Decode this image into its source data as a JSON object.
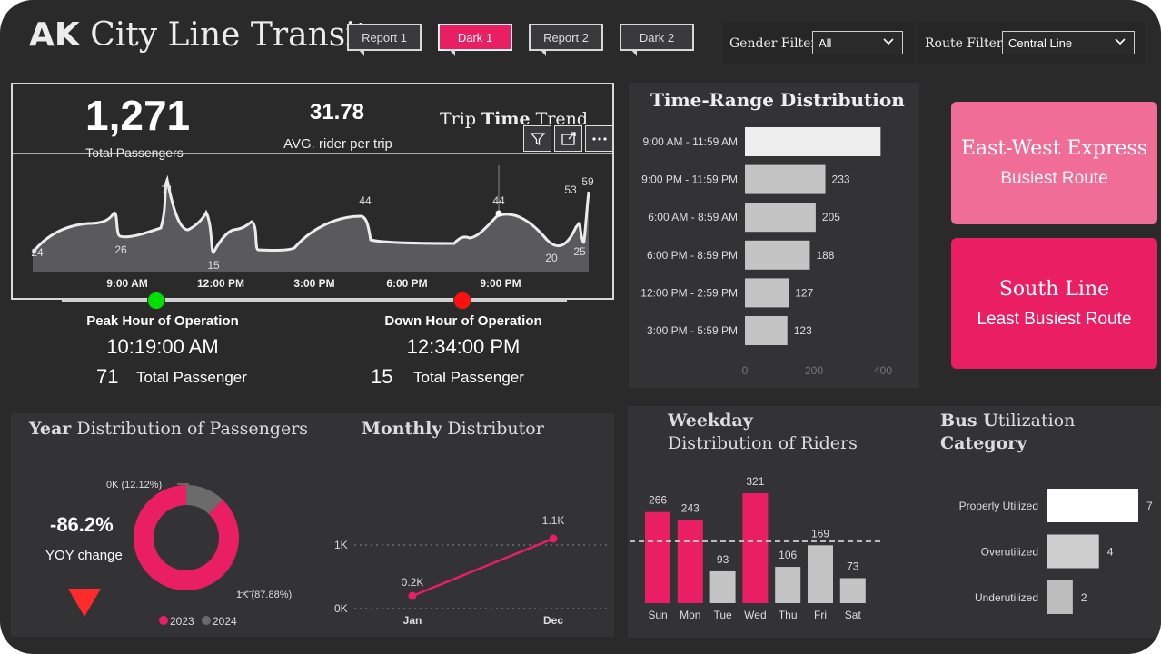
{
  "header": {
    "title_bold": "AK",
    "title_rest": "City Line Transit",
    "buttons": [
      {
        "label": "Report 1",
        "active": false
      },
      {
        "label": "Dark 1",
        "active": true
      },
      {
        "label": "Report 2",
        "active": false
      },
      {
        "label": "Dark 2",
        "active": false
      }
    ],
    "gender_filter": {
      "label": "Gender Filter",
      "value": "All"
    },
    "route_filter": {
      "label": "Route Filter",
      "value": "Central Line"
    }
  },
  "trip_panel": {
    "total_passengers": "1,271",
    "total_passengers_label": "Total Passengers",
    "avg_rider": "31.78",
    "avg_rider_label": "AVG. rider per trip",
    "chart_title_pre": "Trip ",
    "chart_title_bold": "Time",
    "chart_title_post": " Trend",
    "peak": {
      "title": "Peak Hour of Operation",
      "time": "10:19:00 AM",
      "count": "71",
      "count_label": "Total Passenger"
    },
    "down": {
      "title": "Down Hour of Operation",
      "time": "12:34:00 PM",
      "count": "15",
      "count_label": "Total Passenger"
    }
  },
  "colors": {
    "accent": "#e91e63",
    "kpi_light": "#f06d97",
    "bar_grey": "#c4c4c4",
    "green": "#00e000",
    "red": "#ff1010"
  },
  "icons": [
    "filter-icon",
    "focus-mode-icon",
    "more-options-icon",
    "chevron-down-icon",
    "down-arrow-icon"
  ],
  "time_range": {
    "title": "Time-Range Distribution",
    "categories": [
      "9:00 AM - 11:59 AM",
      "9:00 PM - 11:59 PM",
      "6:00 AM - 8:59 AM",
      "6:00 PM - 8:59 PM",
      "12:00 PM - 2:59 PM",
      "3:00 PM - 5:59 PM"
    ],
    "values": [
      393,
      233,
      205,
      188,
      127,
      123
    ],
    "value_labels": [
      "",
      "233",
      "205",
      "188",
      "127",
      "123"
    ],
    "ticks": [
      "0",
      "200",
      "400"
    ]
  },
  "kpi_cards": {
    "busiest_route": "East-West Express",
    "busiest_label": "Busiest Route",
    "least_route": "South Line",
    "least_label": "Least Busiest Route"
  },
  "year_panel": {
    "title_bold": "Year",
    "title_rest": " Distribution of Passengers",
    "yoy_value": "-86.2%",
    "yoy_label": "YOY change",
    "slice_2024_label": "0K (12.12%)",
    "slice_2023_label": "1K (87.88%)",
    "legend": [
      "2023",
      "2024"
    ]
  },
  "monthly_panel": {
    "title_bold": "Monthly",
    "title_rest": " Distributor",
    "y_ticks": [
      "1K",
      "0K"
    ],
    "x_labels": [
      "Jan",
      "Dec"
    ],
    "point_labels": [
      "0.2K",
      "1.1K"
    ]
  },
  "weekday_panel": {
    "title_bold": "Weekday",
    "title_rest": "Distribution of Riders",
    "days": [
      "Sun",
      "Mon",
      "Tue",
      "Wed",
      "Thu",
      "Fri",
      "Sat"
    ],
    "value_labels": [
      "266",
      "243",
      "93",
      "321",
      "106",
      "169",
      "73"
    ]
  },
  "bus_panel": {
    "title_bold1": "Bus U",
    "title_rest1": "tilization",
    "title_line2": "Category",
    "categories": [
      "Properly Utilized",
      "Overutilized",
      "Underutilized"
    ],
    "value_labels": [
      "7",
      "4",
      "2"
    ]
  },
  "chart_data": [
    {
      "type": "area",
      "title": "Trip Time Trend",
      "x_ticks": [
        "9:00 AM",
        "12:00 PM",
        "3:00 PM",
        "6:00 PM",
        "9:00 PM"
      ],
      "point_labels": [
        "24",
        "26",
        "71",
        "15",
        "44",
        "44",
        "20",
        "53",
        "25",
        "59"
      ],
      "grid": false
    },
    {
      "type": "bar",
      "orientation": "horizontal",
      "title": "Time-Range Distribution",
      "categories": [
        "9:00 AM - 11:59 AM",
        "9:00 PM - 11:59 PM",
        "6:00 AM - 8:59 AM",
        "6:00 PM - 8:59 PM",
        "12:00 PM - 2:59 PM",
        "3:00 PM - 5:59 PM"
      ],
      "values": [
        393,
        233,
        205,
        188,
        127,
        123
      ],
      "xlim": [
        0,
        400
      ]
    },
    {
      "type": "pie",
      "title": "Year Distribution of Passengers",
      "categories": [
        "2023",
        "2024"
      ],
      "values": [
        87.88,
        12.12
      ]
    },
    {
      "type": "line",
      "title": "Monthly Distributor",
      "x": [
        "Jan",
        "Dec"
      ],
      "values": [
        0.2,
        1.1
      ],
      "ylabel": "",
      "ylim": [
        0,
        1.2
      ]
    },
    {
      "type": "bar",
      "title": "Weekday Distribution of Riders",
      "categories": [
        "Sun",
        "Mon",
        "Tue",
        "Wed",
        "Thu",
        "Fri",
        "Sat"
      ],
      "values": [
        266,
        243,
        93,
        321,
        106,
        169,
        73
      ],
      "ylim": [
        0,
        340
      ]
    },
    {
      "type": "bar",
      "orientation": "horizontal",
      "title": "Bus Utilization Category",
      "categories": [
        "Properly Utilized",
        "Overutilized",
        "Underutilized"
      ],
      "values": [
        7,
        4,
        2
      ]
    }
  ]
}
